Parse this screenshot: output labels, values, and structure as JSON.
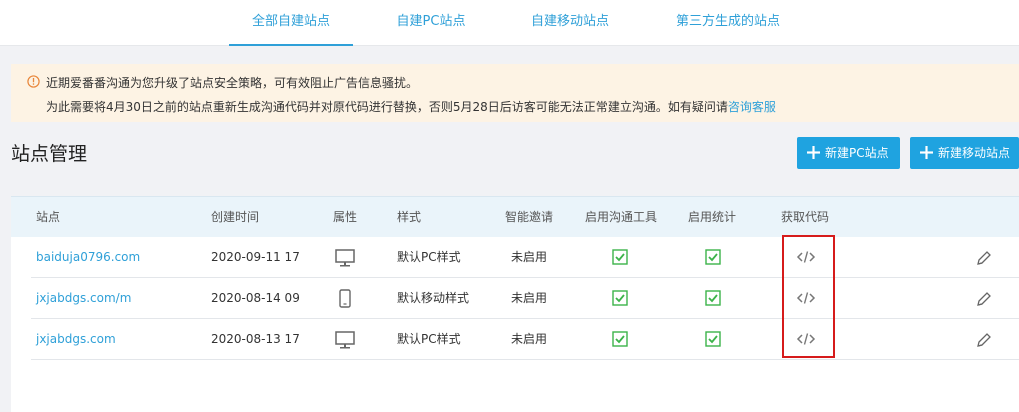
{
  "tabs": [
    {
      "label": "全部自建站点",
      "active": true
    },
    {
      "label": "自建PC站点",
      "active": false
    },
    {
      "label": "自建移动站点",
      "active": false
    },
    {
      "label": "第三方生成的站点",
      "active": false
    }
  ],
  "notice": {
    "line1": "近期爱番番沟通为您升级了站点安全策略，可有效阻止广告信息骚扰。",
    "line2_text": "为此需要将4月30日之前的站点重新生成沟通代码并对原代码进行替换，否则5月28日后访客可能无法正常建立沟通。如有疑问请",
    "line2_link": "咨询客服",
    "icon": "info-circle-icon"
  },
  "page_title": "站点管理",
  "buttons": {
    "new_pc": "新建PC站点",
    "new_mobile": "新建移动站点"
  },
  "table": {
    "columns": [
      "站点",
      "创建时间",
      "属性",
      "样式",
      "智能邀请",
      "启用沟通工具",
      "启用统计",
      "获取代码"
    ],
    "rows": [
      {
        "site": "baiduja0796.com",
        "created": "2020-09-11 17:",
        "device": "desktop",
        "style": "默认PC样式",
        "invite": "未启用",
        "chat_tool": true,
        "stats": true
      },
      {
        "site": "jxjabdgs.com/m",
        "created": "2020-08-14 09:",
        "device": "mobile",
        "style": "默认移动样式",
        "invite": "未启用",
        "chat_tool": true,
        "stats": true
      },
      {
        "site": "jxjabdgs.com",
        "created": "2020-08-13 17:",
        "device": "desktop",
        "style": "默认PC样式",
        "invite": "未启用",
        "chat_tool": true,
        "stats": true
      }
    ]
  },
  "colors": {
    "accent": "#2fa0d8",
    "button": "#1fa3e0",
    "check": "#3cb34a",
    "highlight": "#d61b1b",
    "notice_bg": "#fdf3e4"
  }
}
